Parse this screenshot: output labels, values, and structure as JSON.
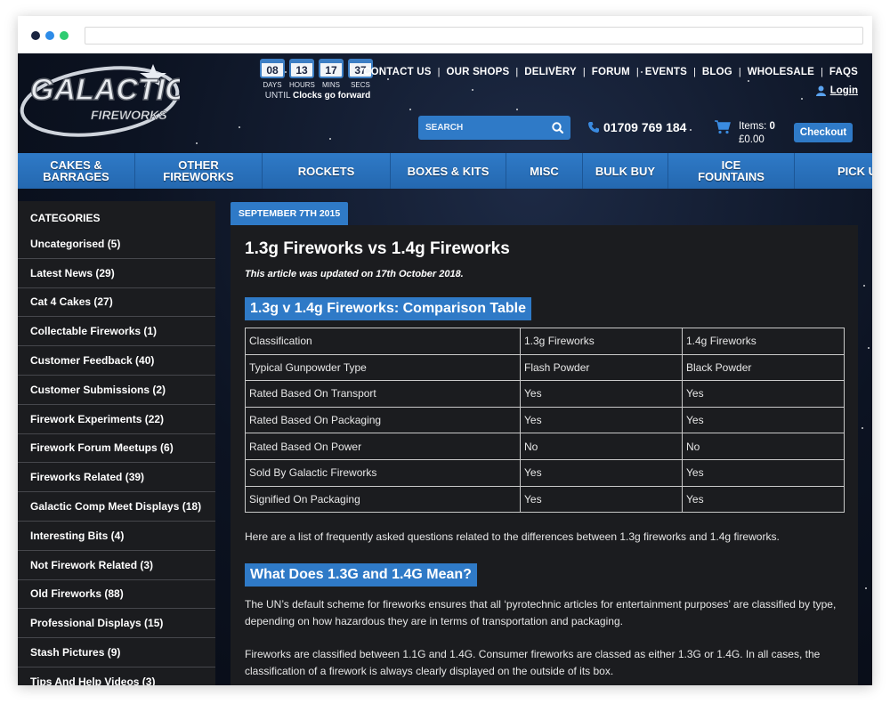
{
  "logo": {
    "text": "GALACTIC",
    "sub": "FIREWORKS"
  },
  "countdown": {
    "items": [
      {
        "value": "08",
        "label": "DAYS"
      },
      {
        "value": "13",
        "label": "HOURS"
      },
      {
        "value": "17",
        "label": "MINS"
      },
      {
        "value": "37",
        "label": "SECS"
      }
    ],
    "until_prefix": "UNTIL",
    "until_bold": "Clocks go forward"
  },
  "topnav": [
    "CONTACT US",
    "OUR SHOPS",
    "DELIVERY",
    "FORUM",
    "EVENTS",
    "BLOG",
    "WHOLESALE",
    "FAQS"
  ],
  "login_label": "Login",
  "search": {
    "placeholder": "SEARCH"
  },
  "phone": "01709 769 184",
  "cart": {
    "items_label": "Items:",
    "items_count": "0",
    "total": "£0.00"
  },
  "checkout_label": "Checkout",
  "mainnav": [
    "CAKES &\nBARRAGES",
    "OTHER\nFIREWORKS",
    "ROCKETS",
    "BOXES & KITS",
    "MISC",
    "BULK BUY",
    "ICE\nFOUNTAINS",
    "PICK UP ONLY"
  ],
  "sidebar": {
    "title": "CATEGORIES",
    "items": [
      "Uncategorised (5)",
      "Latest News (29)",
      "Cat 4 Cakes (27)",
      "Collectable Fireworks (1)",
      "Customer Feedback (40)",
      "Customer Submissions (2)",
      "Firework Experiments (22)",
      "Firework Forum Meetups (6)",
      "Fireworks Related (39)",
      "Galactic Comp Meet Displays (18)",
      "Interesting Bits (4)",
      "Not Firework Related (3)",
      "Old Fireworks (88)",
      "Professional Displays (15)",
      "Stash Pictures (9)",
      "Tips And Help Videos (3)"
    ]
  },
  "post": {
    "date": "SEPTEMBER 7TH 2015",
    "title": "1.3g Fireworks vs 1.4g Fireworks",
    "updated": "This article was updated on 17th October 2018.",
    "table_heading": "1.3g v 1.4g Fireworks: Comparison Table",
    "table": [
      [
        "Classification",
        "1.3g Fireworks",
        "1.4g Fireworks"
      ],
      [
        "Typical Gunpowder Type",
        "Flash Powder",
        "Black Powder"
      ],
      [
        "Rated Based On Transport",
        "Yes",
        "Yes"
      ],
      [
        "Rated Based On Packaging",
        "Yes",
        "Yes"
      ],
      [
        "Rated Based On Power",
        "No",
        "No"
      ],
      [
        "Sold By Galactic Fireworks",
        "Yes",
        "Yes"
      ],
      [
        "Signified On Packaging",
        "Yes",
        "Yes"
      ]
    ],
    "intro": "Here are a list of frequently asked questions related to the differences between 1.3g fireworks and 1.4g fireworks.",
    "faq_heading": "What Does 1.3G and 1.4G Mean?",
    "p1": "The UN’s default scheme for fireworks ensures that all ‘pyrotechnic articles for entertainment purposes’ are classified by type, depending on how hazardous they are in terms of transportation and packaging.",
    "p2": "Fireworks are classified between 1.1G and 1.4G. Consumer fireworks are classed as either 1.3G or 1.4G. In all cases, the classification of a firework is always clearly displayed on the outside of its box."
  }
}
